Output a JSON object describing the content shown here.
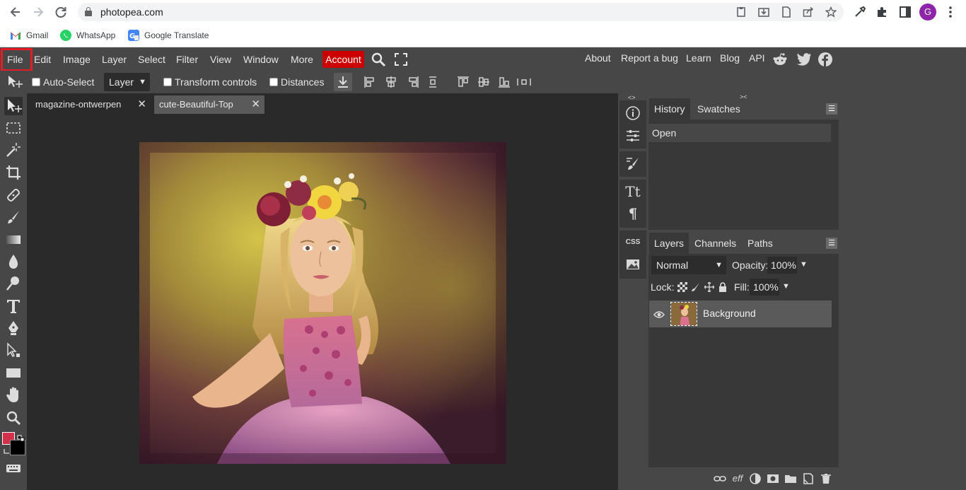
{
  "browser": {
    "url": "photopea.com",
    "avatar_letter": "G",
    "avatar_color": "#8e24aa",
    "bookmarks": [
      {
        "label": "Gmail",
        "icon": "gmail-icon"
      },
      {
        "label": "WhatsApp",
        "icon": "whatsapp-icon"
      },
      {
        "label": "Google Translate",
        "icon": "google-translate-icon"
      }
    ]
  },
  "menu": {
    "items": [
      "File",
      "Edit",
      "Image",
      "Layer",
      "Select",
      "Filter",
      "View",
      "Window",
      "More"
    ],
    "account": "Account",
    "right": [
      "About",
      "Report a bug",
      "Learn",
      "Blog",
      "API"
    ],
    "highlighted": "File",
    "highlight_color": "#e31c25",
    "account_color": "#cc0000"
  },
  "options": {
    "auto_select": "Auto-Select",
    "layer_select": "Layer",
    "transform_controls": "Transform controls",
    "distances": "Distances"
  },
  "documents": {
    "tabs": [
      {
        "label": "magazine-ontwerpen",
        "active": true
      },
      {
        "label": "cute-Beautiful-Top",
        "active": false
      }
    ]
  },
  "history": {
    "tabs": [
      "History",
      "Swatches"
    ],
    "entries": [
      "Open"
    ]
  },
  "layers": {
    "tabs": [
      "Layers",
      "Channels",
      "Paths"
    ],
    "blend_mode": "Normal",
    "opacity_label": "Opacity:",
    "opacity": "100%",
    "lock_label": "Lock:",
    "fill_label": "Fill:",
    "fill": "100%",
    "items": [
      {
        "name": "Background",
        "visible": true
      }
    ]
  },
  "iconstrip": {
    "css_label": "CSS",
    "text_label": "Tt",
    "para_label": "¶"
  },
  "footer": {
    "fx_label": "eff"
  },
  "colors": {
    "foreground": "#d2304b",
    "background": "#000000"
  }
}
